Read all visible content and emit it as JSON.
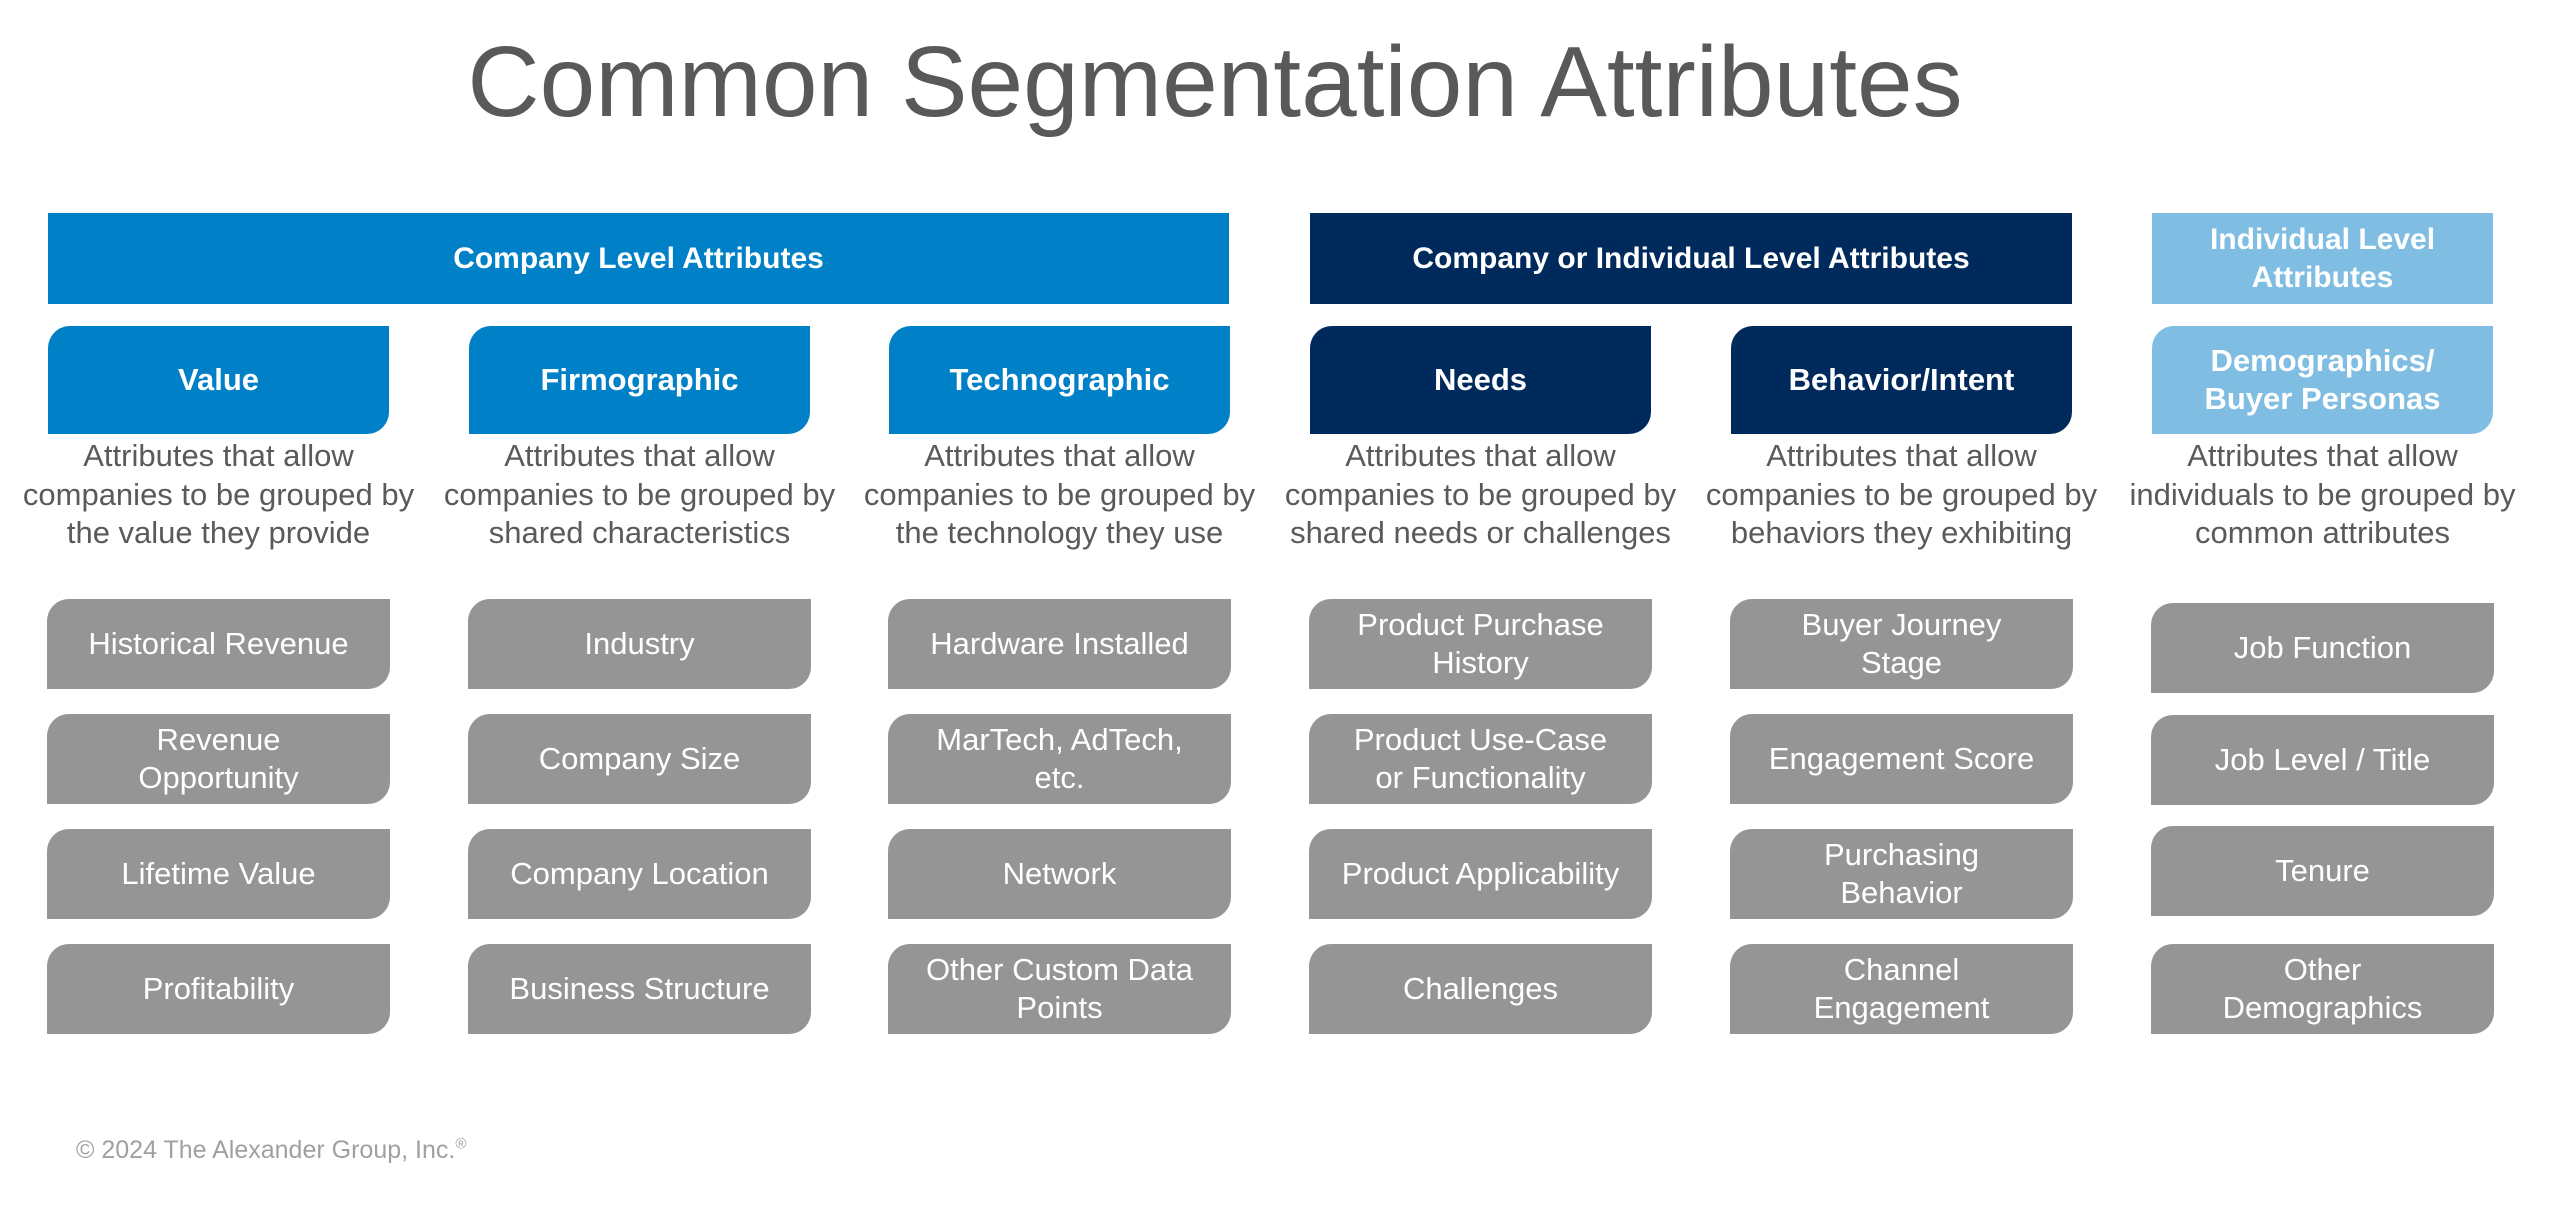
{
  "title": "Common Segmentation Attributes",
  "colors": {
    "company_blue": "#0080c6",
    "navy": "#002a5c",
    "light_blue": "#7fbde2",
    "item_gray": "#959595",
    "text_gray": "#5a5a5a"
  },
  "bands": [
    {
      "label": "Company Level Attributes",
      "theme": "blue"
    },
    {
      "label": "Company or Individual Level Attributes",
      "theme": "navy"
    },
    {
      "label": "Individual Level Attributes",
      "theme": "light"
    }
  ],
  "columns": [
    {
      "header": "Value",
      "theme": "blue",
      "description": "Attributes that allow companies to be grouped by the value they provide",
      "items": [
        "Historical Revenue",
        "Revenue\nOpportunity",
        "Lifetime Value",
        "Profitability"
      ]
    },
    {
      "header": "Firmographic",
      "theme": "blue",
      "description": "Attributes that allow companies to be grouped by shared characteristics",
      "items": [
        "Industry",
        "Company Size",
        "Company Location",
        "Business Structure"
      ]
    },
    {
      "header": "Technographic",
      "theme": "blue",
      "description": "Attributes that allow companies to be grouped by the technology they use",
      "items": [
        "Hardware Installed",
        "MarTech, AdTech,\netc.",
        "Network",
        "Other Custom Data\nPoints"
      ]
    },
    {
      "header": "Needs",
      "theme": "navy",
      "description": "Attributes that allow companies to be grouped by shared needs or challenges",
      "items": [
        "Product Purchase\nHistory",
        "Product Use-Case\nor Functionality",
        "Product Applicability",
        "Challenges"
      ]
    },
    {
      "header": "Behavior/Intent",
      "theme": "navy",
      "description": "Attributes that allow companies to be grouped by behaviors they exhibiting",
      "items": [
        "Buyer Journey\nStage",
        "Engagement Score",
        "Purchasing\nBehavior",
        "Channel\nEngagement"
      ]
    },
    {
      "header": "Demographics/ Buyer Personas",
      "theme": "light",
      "description": "Attributes that allow individuals to be grouped by common attributes",
      "items": [
        "Job Function",
        "Job Level / Title",
        "Tenure",
        "Other\nDemographics"
      ]
    }
  ],
  "footer": {
    "text": "© 2024 The Alexander Group, Inc.",
    "mark": "®"
  }
}
